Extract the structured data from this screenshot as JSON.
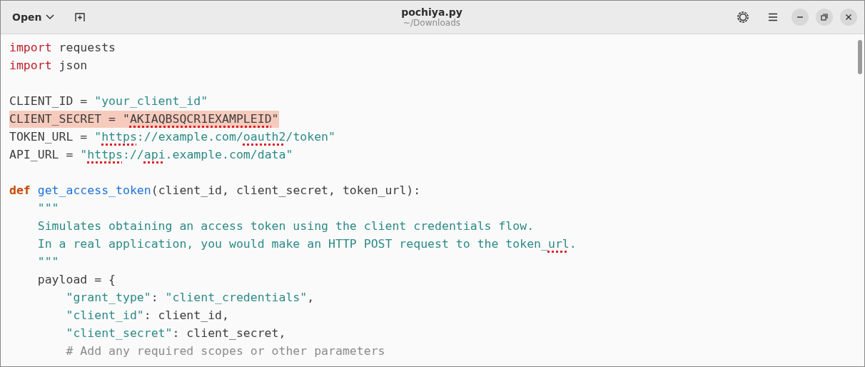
{
  "header": {
    "open_button": "Open",
    "title": "pochiya.py",
    "subtitle": "~/Downloads"
  },
  "blocks": [
    {
      "lines": [
        {
          "tokens": [
            {
              "text": "import",
              "kind": "keyword"
            },
            {
              "text": " requests",
              "kind": "plain"
            }
          ]
        },
        {
          "tokens": [
            {
              "text": "import",
              "kind": "keyword"
            },
            {
              "text": " json",
              "kind": "plain"
            }
          ]
        }
      ]
    },
    {
      "lines": [
        {
          "tokens": [
            {
              "text": "CLIENT_ID = ",
              "kind": "plain"
            },
            {
              "text": "\"your_client_id\"",
              "kind": "string"
            }
          ]
        },
        {
          "highlighted": true,
          "tokens": [
            {
              "text": "CLIENT_SECRET = \"",
              "kind": "plain"
            },
            {
              "text": "AKIAQBSQCR1EXAMPLEID",
              "kind": "plain",
              "misspelled": true
            },
            {
              "text": "\"",
              "kind": "plain"
            }
          ]
        },
        {
          "tokens": [
            {
              "text": "TOKEN_URL = ",
              "kind": "plain"
            },
            {
              "text": "\"",
              "kind": "string"
            },
            {
              "text": "https",
              "kind": "string",
              "misspelled": true
            },
            {
              "text": "://example.com/",
              "kind": "string"
            },
            {
              "text": "oauth2",
              "kind": "string",
              "misspelled": true
            },
            {
              "text": "/token\"",
              "kind": "string"
            }
          ]
        },
        {
          "tokens": [
            {
              "text": "API_URL = ",
              "kind": "plain"
            },
            {
              "text": "\"",
              "kind": "string"
            },
            {
              "text": "https",
              "kind": "string",
              "misspelled": true
            },
            {
              "text": "://",
              "kind": "string"
            },
            {
              "text": "api",
              "kind": "string",
              "misspelled": true
            },
            {
              "text": ".example.com/data\"",
              "kind": "string"
            }
          ]
        }
      ]
    },
    {
      "lines": [
        {
          "tokens": [
            {
              "text": "def ",
              "kind": "def"
            },
            {
              "text": "get_access_token",
              "kind": "func"
            },
            {
              "text": "(client_id, client_secret, token_url):",
              "kind": "plain"
            }
          ]
        },
        {
          "tokens": [
            {
              "text": "    \"\"\"",
              "kind": "string"
            }
          ]
        },
        {
          "tokens": [
            {
              "text": "    Simulates obtaining an access token using the client credentials flow.",
              "kind": "string"
            }
          ]
        },
        {
          "tokens": [
            {
              "text": "    In a real application, you would make an HTTP POST request to the token_",
              "kind": "string"
            },
            {
              "text": "url",
              "kind": "string",
              "misspelled": true
            },
            {
              "text": ".",
              "kind": "string"
            }
          ]
        },
        {
          "tokens": [
            {
              "text": "    \"\"\"",
              "kind": "string"
            }
          ]
        },
        {
          "tokens": [
            {
              "text": "    payload = {",
              "kind": "plain"
            }
          ]
        },
        {
          "tokens": [
            {
              "text": "        \"grant_type\"",
              "kind": "string"
            },
            {
              "text": ": ",
              "kind": "plain"
            },
            {
              "text": "\"client_credentials\"",
              "kind": "string"
            },
            {
              "text": ",",
              "kind": "plain"
            }
          ]
        },
        {
          "tokens": [
            {
              "text": "        \"client_id\"",
              "kind": "string"
            },
            {
              "text": ": client_id,",
              "kind": "plain"
            }
          ]
        },
        {
          "tokens": [
            {
              "text": "        \"client_secret\"",
              "kind": "string"
            },
            {
              "text": ": client_secret,",
              "kind": "plain"
            }
          ]
        },
        {
          "tokens": [
            {
              "text": "        # Add any required scopes or other parameters",
              "kind": "comment"
            }
          ]
        }
      ]
    }
  ]
}
